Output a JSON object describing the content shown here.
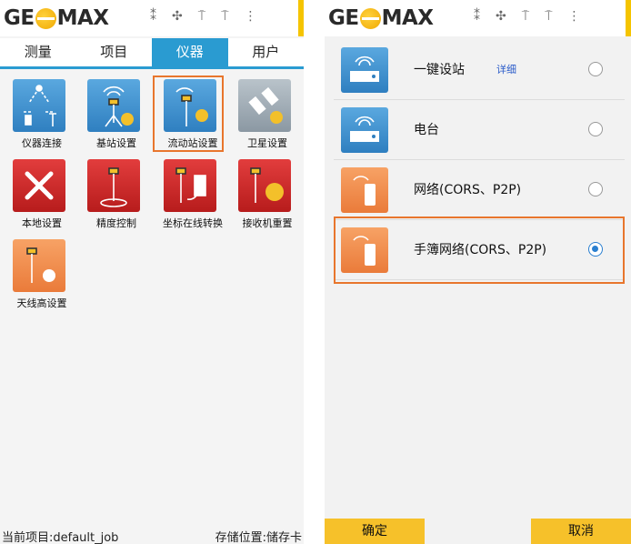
{
  "left": {
    "logo": {
      "left": "GE",
      "right": "MAX"
    },
    "status_icons": [
      "bluetooth-icon",
      "satellite-icon",
      "antenna-icon",
      "radio-icon",
      "more-icon"
    ],
    "status_glyphs": [
      "⁑",
      "✣",
      "⍑",
      "⍑",
      "⋮"
    ],
    "tabs": [
      {
        "label": "测量",
        "active": false
      },
      {
        "label": "项目",
        "active": false
      },
      {
        "label": "仪器",
        "active": true
      },
      {
        "label": "用户",
        "active": false
      }
    ],
    "grid": [
      {
        "label": "仪器连接",
        "color": "blue"
      },
      {
        "label": "基站设置",
        "color": "blue"
      },
      {
        "label": "流动站设置",
        "color": "blue"
      },
      {
        "label": "卫星设置",
        "color": "gray"
      },
      {
        "label": "本地设置",
        "color": "red"
      },
      {
        "label": "精度控制",
        "color": "red"
      },
      {
        "label": "坐标在线转换",
        "color": "red"
      },
      {
        "label": "接收机重置",
        "color": "red"
      },
      {
        "label": "天线高设置",
        "color": "orange"
      }
    ],
    "footer": {
      "project": "当前项目:default_job",
      "storage": "存储位置:储存卡"
    }
  },
  "right": {
    "logo": {
      "left": "GE",
      "right": "MAX"
    },
    "list": [
      {
        "title": "一键设站",
        "sub": "详细",
        "selected": false,
        "color": "blue"
      },
      {
        "title": "电台",
        "sub": "",
        "selected": false,
        "color": "blue"
      },
      {
        "title": "网络(CORS、P2P)",
        "sub": "",
        "selected": false,
        "color": "orange"
      },
      {
        "title": "手簿网络(CORS、P2P)",
        "sub": "",
        "selected": true,
        "color": "orange"
      }
    ],
    "buttons": {
      "ok": "确定",
      "cancel": "取消"
    }
  },
  "colors": {
    "accent": "#2a9bd1",
    "highlight": "#e8762d",
    "button": "#f6c12a"
  }
}
